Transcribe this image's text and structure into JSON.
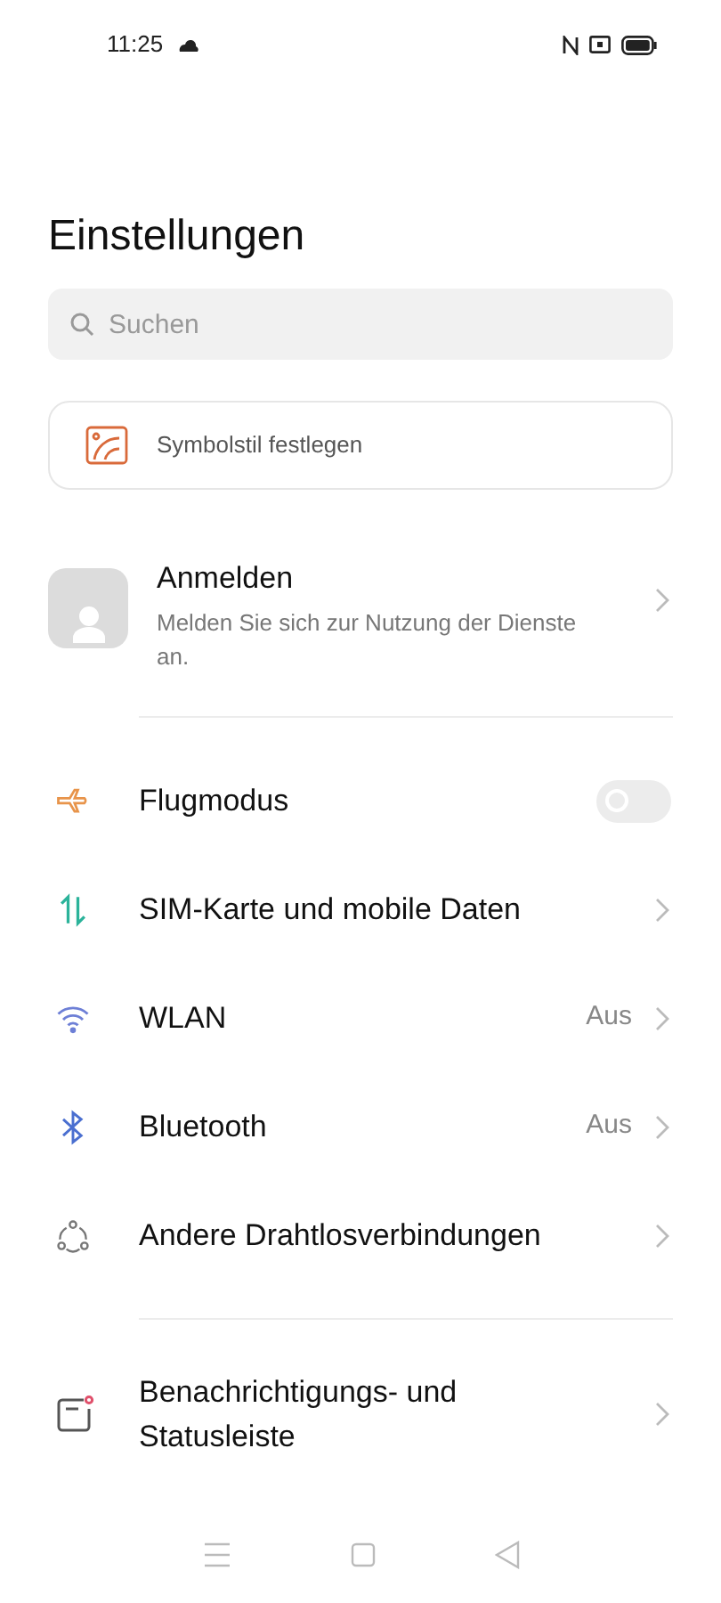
{
  "status_bar": {
    "time": "11:25"
  },
  "title": "Einstellungen",
  "search": {
    "placeholder": "Suchen"
  },
  "icon_style_card": {
    "label": "Symbolstil festlegen"
  },
  "account": {
    "title": "Anmelden",
    "subtitle": "Melden Sie sich zur Nutzung der Dienste an."
  },
  "groups": [
    [
      {
        "kind": "toggle",
        "label": "Flugmodus",
        "on": false
      },
      {
        "kind": "link",
        "label": "SIM-Karte und mobile Daten"
      },
      {
        "kind": "link",
        "label": "WLAN",
        "value": "Aus"
      },
      {
        "kind": "link",
        "label": "Bluetooth",
        "value": "Aus"
      },
      {
        "kind": "link",
        "label": "Andere Drahtlosverbindungen"
      }
    ],
    [
      {
        "kind": "link",
        "label": "Benachrichtigungs- und Statusleiste"
      }
    ]
  ]
}
